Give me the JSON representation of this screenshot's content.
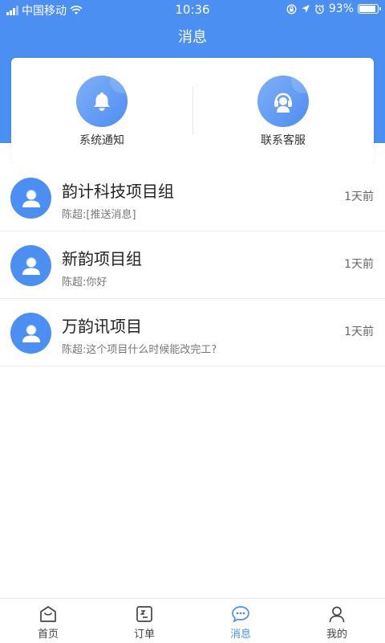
{
  "status_bar": {
    "carrier": "中国移动",
    "time": "10:36",
    "battery_percent": "93%",
    "battery_level": 0.93
  },
  "header": {
    "title": "消息"
  },
  "shortcuts": [
    {
      "label": "系统通知",
      "icon": "bell-icon"
    },
    {
      "label": "联系客服",
      "icon": "headset-icon"
    }
  ],
  "conversations": [
    {
      "title": "韵计科技项目组",
      "last_message": "陈超:[推送消息]",
      "time": "1天前",
      "icon": "user-icon"
    },
    {
      "title": "新韵项目组",
      "last_message": "陈超:你好",
      "time": "1天前",
      "icon": "user-icon"
    },
    {
      "title": "万韵讯项目",
      "last_message": "陈超:这个项目什么时候能改完工?",
      "time": "1天前",
      "icon": "user-icon"
    }
  ],
  "tabbar": {
    "active": "消息",
    "items": [
      {
        "label": "首页",
        "icon": "home-icon"
      },
      {
        "label": "订单",
        "icon": "order-icon"
      },
      {
        "label": "消息",
        "icon": "chat-icon"
      },
      {
        "label": "我的",
        "icon": "profile-icon"
      }
    ]
  },
  "colors": {
    "primary": "#4b8ff2",
    "text": "#222222",
    "muted": "#777777"
  }
}
